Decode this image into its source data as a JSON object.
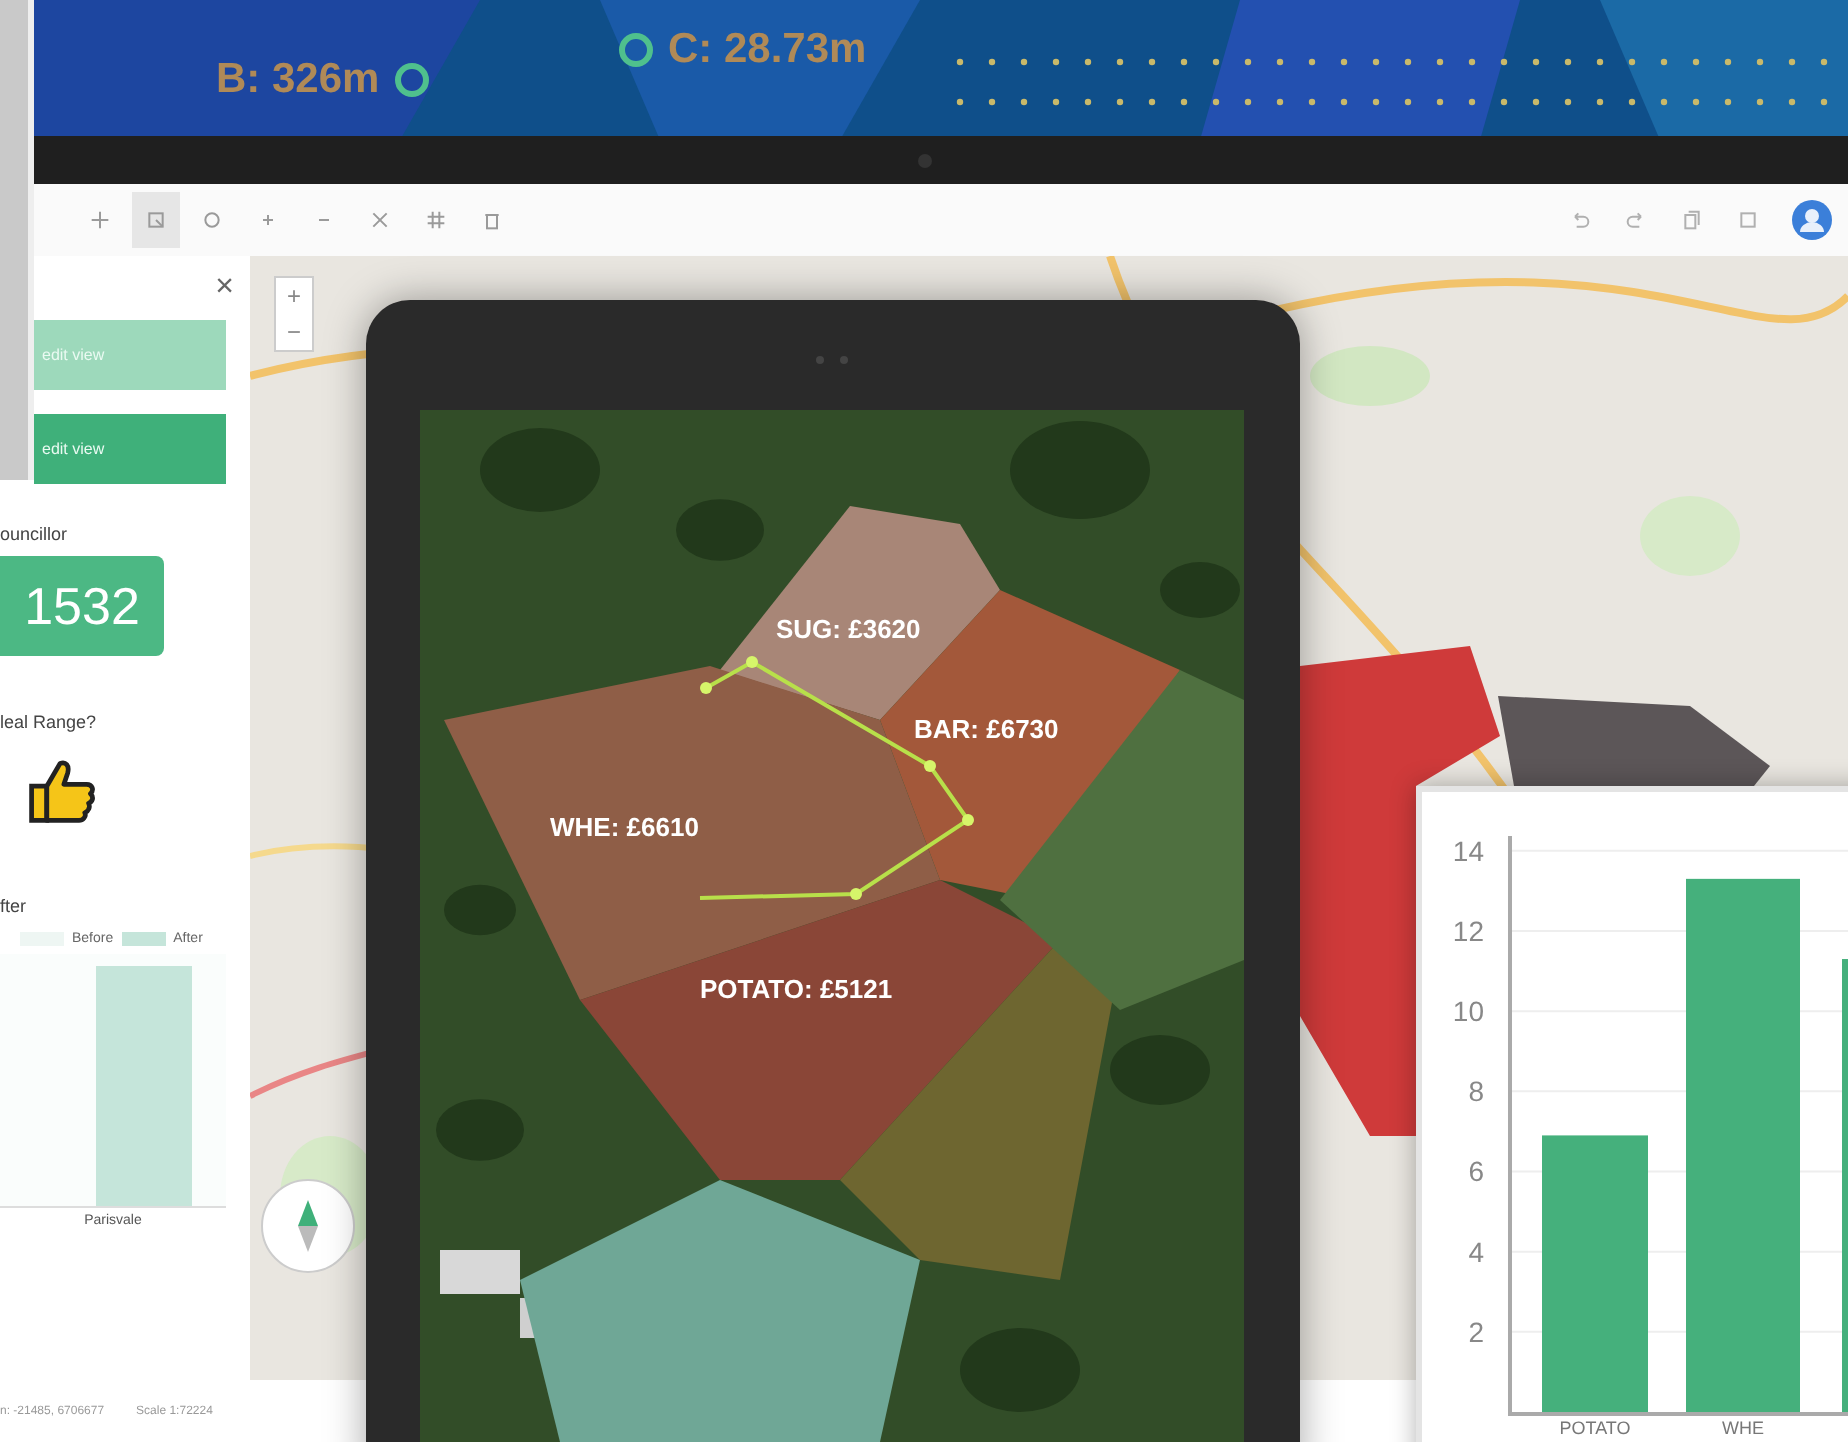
{
  "banner": {
    "measures": [
      {
        "label": "B: 326m",
        "ring": true
      },
      {
        "label": "C: 28.73m",
        "ring": true
      }
    ]
  },
  "toolbar": {
    "tools": [
      {
        "kind": "move",
        "selected": false
      },
      {
        "kind": "select",
        "selected": true
      },
      {
        "kind": "circle",
        "selected": false
      },
      {
        "kind": "plus",
        "selected": false
      },
      {
        "kind": "minus",
        "selected": false
      },
      {
        "kind": "cut",
        "selected": false
      },
      {
        "kind": "grid",
        "selected": false
      },
      {
        "kind": "trash",
        "selected": false
      }
    ],
    "actions": [
      {
        "kind": "undo"
      },
      {
        "kind": "redo"
      },
      {
        "kind": "copy"
      },
      {
        "kind": "square"
      }
    ]
  },
  "panel": {
    "close": "×",
    "buttons": [
      {
        "label": "edit view",
        "selected": false
      },
      {
        "label": "edit view",
        "selected": true
      }
    ],
    "councillor_label": "ouncillor",
    "count": "1532",
    "question": "leal Range?",
    "chart_title": "fter",
    "legend": [
      {
        "label": "Before",
        "color": "#eef6f3"
      },
      {
        "label": "After",
        "color": "#c5e5da"
      }
    ],
    "category": "Parisvale"
  },
  "map": {
    "zoom": [
      "+",
      "−"
    ],
    "districts": [
      {
        "color": "#cf3a3a"
      },
      {
        "color": "#5c5658"
      }
    ]
  },
  "footer": {
    "coords": "n: -21485, 6706677",
    "scale": "Scale 1:72224"
  },
  "tablet": {
    "fields": [
      {
        "label": "SUG: £3620",
        "color": "#a88677"
      },
      {
        "label": "BAR: £6730",
        "color": "#a3583a"
      },
      {
        "label": "WHE: £6610",
        "color": "#8f5e47"
      },
      {
        "label": "POTATO: £5121",
        "color": "#8a4637"
      },
      {
        "color": "#6e6630"
      },
      {
        "color": "#4f7040"
      },
      {
        "color": "#6fa796"
      }
    ]
  },
  "chart": {
    "chart_data": {
      "type": "bar",
      "categories": [
        "POTATO",
        "WHE",
        null
      ],
      "values": [
        6.9,
        13.3,
        11.3
      ],
      "ylim": [
        0,
        14
      ],
      "yticks": [
        2,
        4,
        6,
        8,
        10,
        12,
        14
      ],
      "grid": true
    }
  }
}
